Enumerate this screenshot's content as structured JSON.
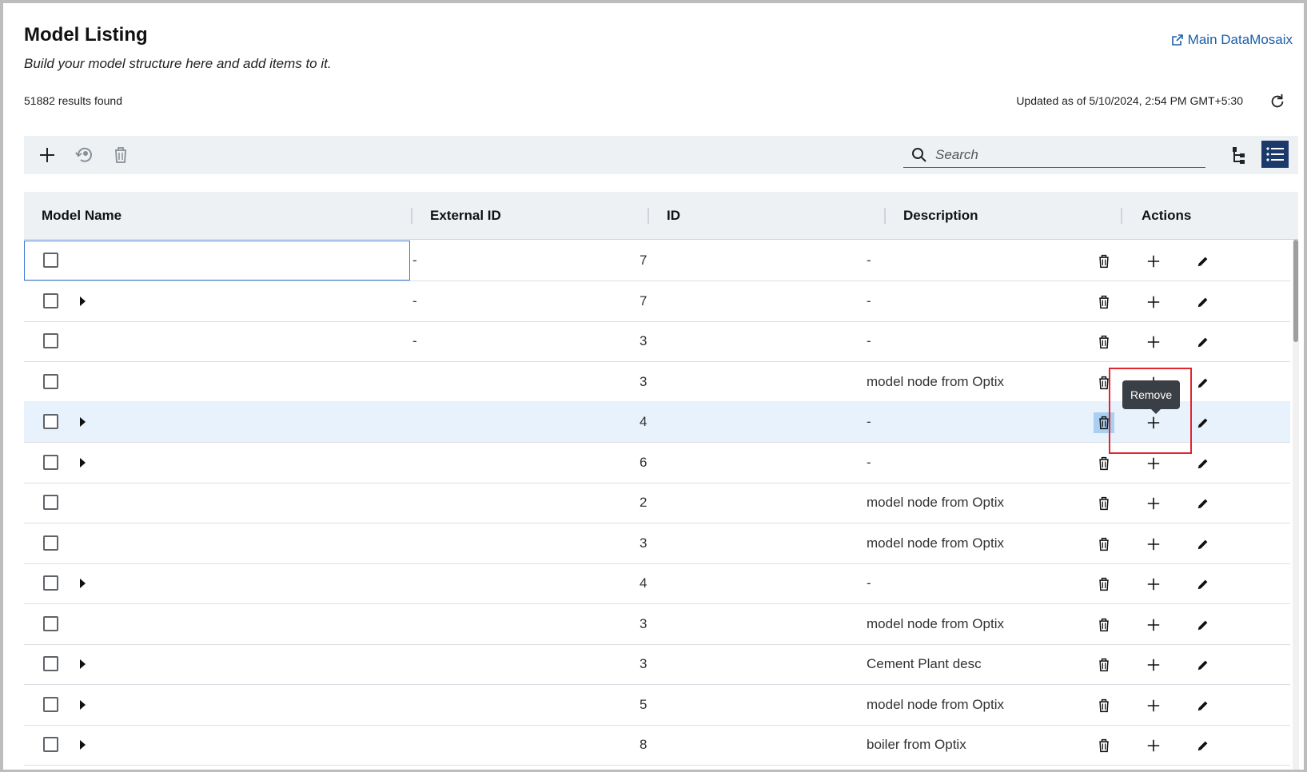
{
  "header": {
    "title": "Model Listing",
    "subtitle": "Build your model structure here and add items to it.",
    "main_link": "Main DataMosaix",
    "results": "51882 results found",
    "updated": "Updated as of 5/10/2024, 2:54 PM GMT+5:30"
  },
  "search": {
    "placeholder": "Search"
  },
  "table": {
    "columns": [
      "Model Name",
      "External ID",
      "ID",
      "Description",
      "Actions"
    ],
    "rows": [
      {
        "expandable": false,
        "external_id": "-",
        "id_prefix": "7",
        "description": "-"
      },
      {
        "expandable": true,
        "external_id": "-",
        "id_prefix": "7",
        "description": "-"
      },
      {
        "expandable": false,
        "external_id": "-",
        "id_prefix": "3",
        "description": "-"
      },
      {
        "expandable": false,
        "external_id": "",
        "id_prefix": "3",
        "description": "model node from Optix"
      },
      {
        "expandable": true,
        "external_id": "",
        "id_prefix": "4",
        "description": "-"
      },
      {
        "expandable": true,
        "external_id": "",
        "id_prefix": "6",
        "description": "-"
      },
      {
        "expandable": false,
        "external_id": "",
        "id_prefix": "2",
        "description": "model node from Optix"
      },
      {
        "expandable": false,
        "external_id": "",
        "id_prefix": "3",
        "description": "model node from Optix"
      },
      {
        "expandable": true,
        "external_id": "",
        "id_prefix": "4",
        "description": "-"
      },
      {
        "expandable": false,
        "external_id": "",
        "id_prefix": "3",
        "description": "model node from Optix"
      },
      {
        "expandable": true,
        "external_id": "",
        "id_prefix": "3",
        "description": "Cement Plant desc"
      },
      {
        "expandable": true,
        "external_id": "",
        "id_prefix": "5",
        "description": "model node from Optix"
      },
      {
        "expandable": true,
        "external_id": "",
        "id_prefix": "8",
        "description": "boiler from Optix"
      }
    ]
  },
  "tooltip": {
    "text": "Remove"
  },
  "icons": [
    "add-icon",
    "restore-icon",
    "trash-icon",
    "search-icon",
    "tree-view-icon",
    "list-view-icon",
    "refresh-icon",
    "external-link-icon",
    "plus-icon",
    "pencil-icon"
  ],
  "colors": {
    "link": "#1a5fa8",
    "toolbar_bg": "#eef1f4",
    "list_active": "#1b3a6b",
    "highlight_row": "#e7f2fc",
    "callout": "#e0262c"
  }
}
